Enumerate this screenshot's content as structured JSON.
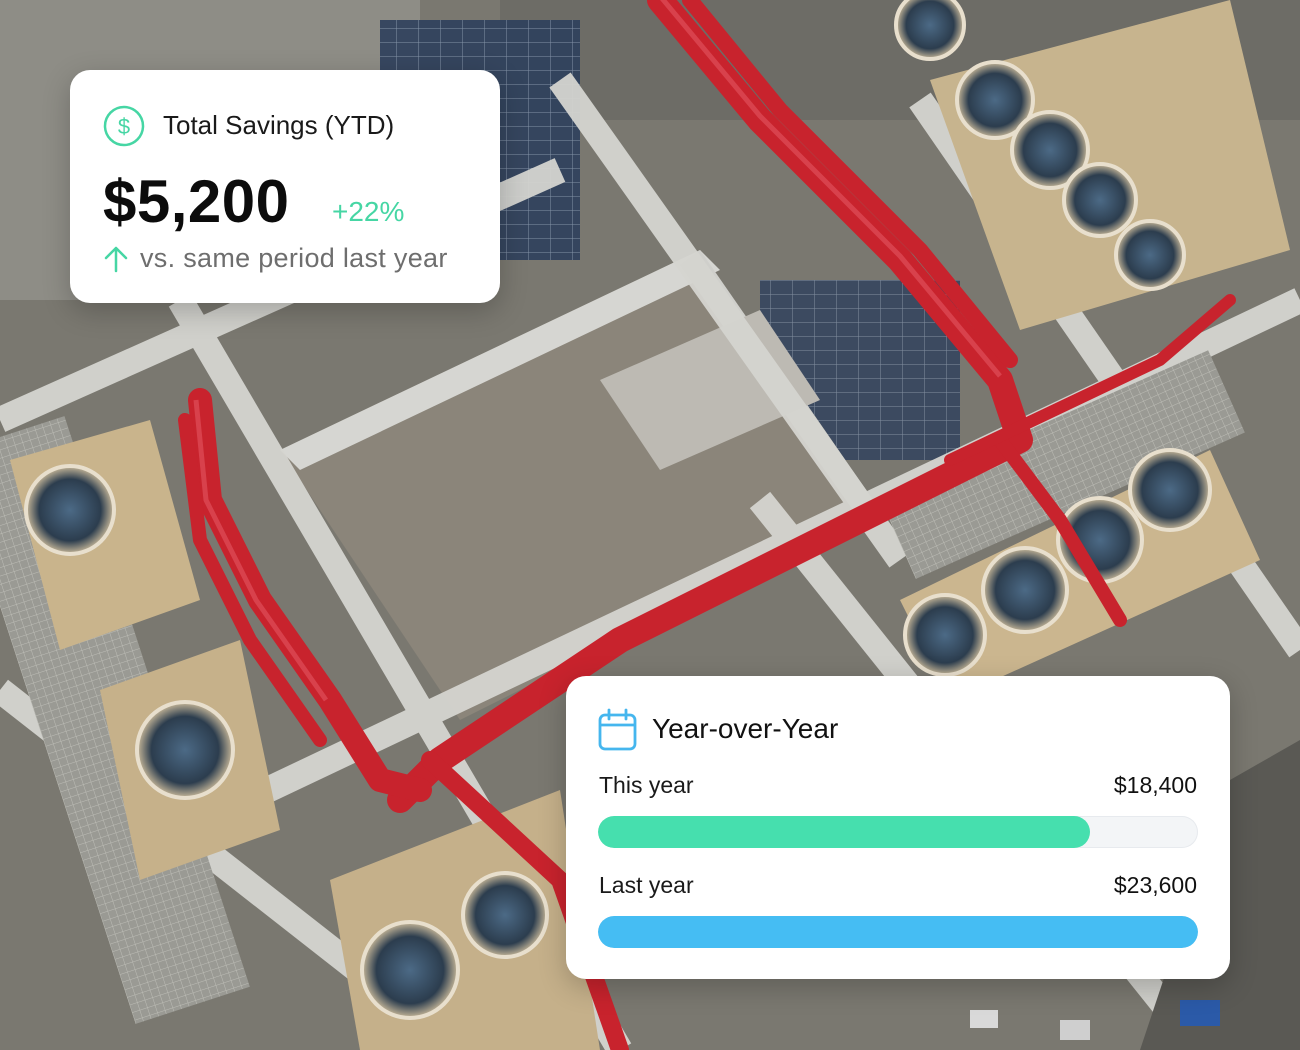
{
  "savings": {
    "title": "Total Savings (YTD)",
    "value": "$5,200",
    "change": "+22%",
    "subtitle": "vs. same period last year",
    "icon": "dollar-circle-icon",
    "arrow_icon": "arrow-up-icon",
    "accent_color": "#46d6a4"
  },
  "yoy": {
    "title": "Year-over-Year",
    "icon": "calendar-icon",
    "rows": [
      {
        "label": "This year",
        "value": "$18,400",
        "fill_fraction": 0.82,
        "color": "#46dfae"
      },
      {
        "label": "Last year",
        "value": "$23,600",
        "fill_fraction": 1.0,
        "color": "#45bdf3"
      }
    ]
  }
}
